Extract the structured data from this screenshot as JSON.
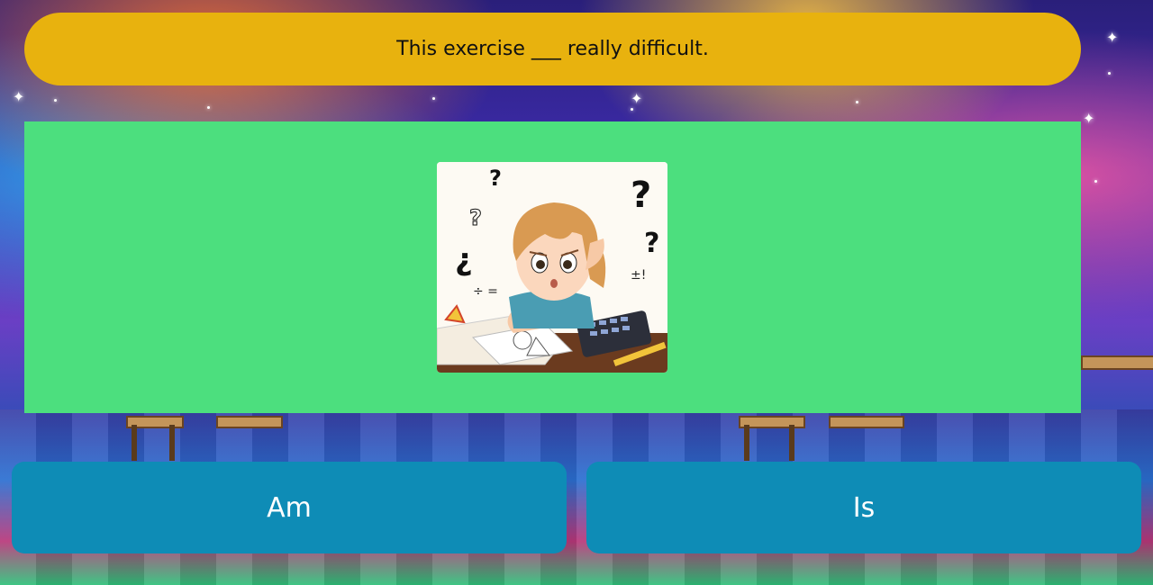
{
  "question": {
    "text": "This exercise ___ really difficult."
  },
  "illustration": {
    "subject": "confused child doing homework with question marks"
  },
  "answers": [
    {
      "label": "Am"
    },
    {
      "label": "Is"
    }
  ],
  "colors": {
    "question_bar": "#e8b20e",
    "image_panel": "#4cdf7e",
    "answer_button": "#0e8cb6",
    "answer_text": "#ffffff"
  }
}
